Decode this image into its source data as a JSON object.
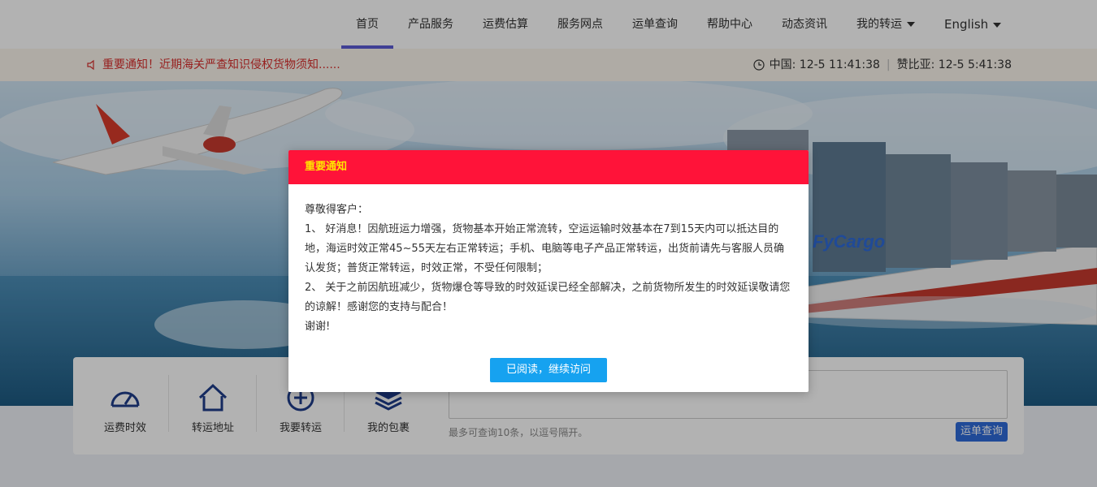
{
  "nav": {
    "items": [
      {
        "label": "首页",
        "active": true
      },
      {
        "label": "产品服务",
        "active": false
      },
      {
        "label": "运费估算",
        "active": false
      },
      {
        "label": "服务网点",
        "active": false
      },
      {
        "label": "运单查询",
        "active": false
      },
      {
        "label": "帮助中心",
        "active": false
      },
      {
        "label": "动态资讯",
        "active": false
      }
    ],
    "my_transfer": "我的转运",
    "language": "English"
  },
  "notice": {
    "text": "重要通知！近期海关严查知识侵权货物须知......",
    "time_china": "中国: 12-5 11:41:38",
    "time_zambia": "赞比亚: 12-5  5:41:38"
  },
  "banner": {
    "logo_text": "FyCargo"
  },
  "tools": [
    {
      "label": "运费时效",
      "icon": "speedometer-icon"
    },
    {
      "label": "转运地址",
      "icon": "home-icon"
    },
    {
      "label": "我要转运",
      "icon": "plus-circle-icon"
    },
    {
      "label": "我的包裹",
      "icon": "layers-icon"
    }
  ],
  "query": {
    "hint": "最多可查询10条，以逗号隔开。",
    "button": "运单查询"
  },
  "modal": {
    "title": "重要通知",
    "greeting": "尊敬得客户：",
    "para1": "1、 好消息！因航班运力增强，货物基本开始正常流转，空运运输时效基本在7到15天内可以抵达目的地，海运时效正常45~55天左右正常转运；手机、电脑等电子产品正常转运，出货前请先与客服人员确认发货；普货正常转运，时效正常，不受任何限制；",
    "para2": "2、 关于之前因航班减少，货物爆仓等导致的时效延误已经全部解决，之前货物所发生的时效延误敬请您的谅解！感谢您的支持与配合！",
    "closing": "谢谢!",
    "button": "已阅读，继续访问"
  },
  "colors": {
    "modal_header": "#ff1339",
    "modal_title": "#ffe400",
    "modal_button": "#16a2f0",
    "nav_active": "#5b5bd6",
    "notice_text": "#d9302e"
  }
}
